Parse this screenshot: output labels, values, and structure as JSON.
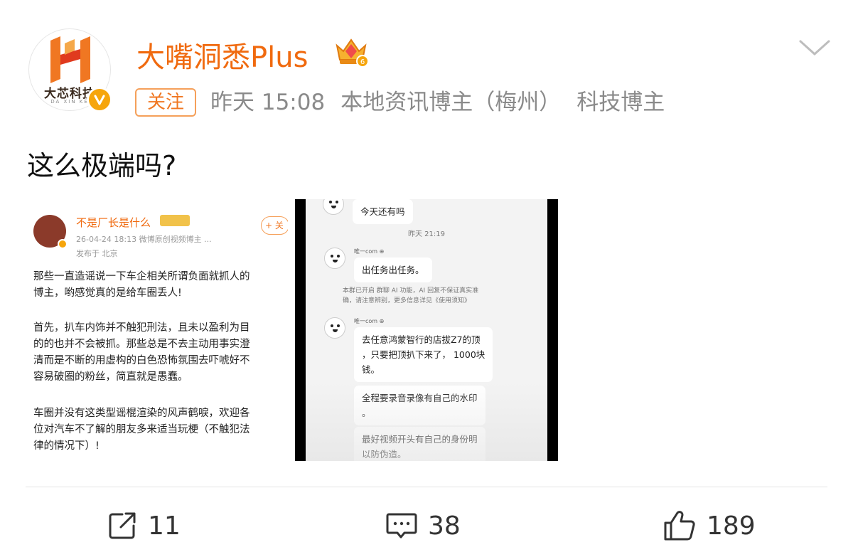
{
  "header": {
    "username": "大嘴洞悉Plus",
    "avatar_text": "大芯科技",
    "avatar_subtext": "DA XIN KE",
    "follow_label": "关注",
    "time": "昨天 15:08",
    "tag_local": "本地资讯博主（梅州）",
    "tag_tech": "科技博主"
  },
  "post": {
    "text": "这么极端吗?"
  },
  "image1": {
    "name": "不是厂长是什么",
    "date": "26-04-24 18:13  微博原创视频博主 ...",
    "location": "发布于 北京",
    "follow": "+ 关",
    "paragraphs": [
      [
        "那些一直造谣说一下车企相关所谓负面就抓人的",
        "博主，哟感觉真的是给车圈丢人!"
      ],
      [
        "首先，扒车内饰并不触犯刑法，且未以盈利为目",
        "的的也并不会被抓。那些总是不去主动用事实澄",
        "清而是不断的用虚构的白色恐怖氛围去吓唬好不",
        "容易破圈的粉丝，简直就是愚蠢。"
      ],
      [
        "车圈并没有这类型谣棍渲染的风声鹤唳，欢迎各",
        "位对汽车不了解的朋友多来适当玩梗（不触犯法",
        "律的情况下）!"
      ]
    ]
  },
  "image2": {
    "msg_top": "今天还有吗",
    "time": "昨天 21:19",
    "nick": "唯一com ⊕",
    "msg_task": "出任务出任务。",
    "notice_1": "本群已开启 群聊 AI 功能，AI 回复不保证真实准",
    "notice_2": "确，请注意辨别，更多信息详见《使用须知》",
    "msg_long_1": "去任意鸿蒙智行的店拔Z7的顶",
    "msg_long_2": "，只要把顶扒下来了， 1000块",
    "msg_long_3": "钱。",
    "msg_rec_1": "全程要录音录像有自己的水印",
    "msg_rec_2": "。",
    "msg_id_1": "最好视频开头有自己的身份明",
    "msg_id_2": "以防伪造。"
  },
  "actions": {
    "repost_count": "11",
    "comment_count": "38",
    "like_count": "189"
  },
  "colors": {
    "accent": "#f06a0f",
    "follow_border": "#f5a05a",
    "meta_gray": "#8a8a8a",
    "badge": "#f6a50c"
  },
  "icons": [
    "chevron-down-icon",
    "crown-vip-icon",
    "verified-icon",
    "repost-icon",
    "comment-icon",
    "like-icon"
  ]
}
